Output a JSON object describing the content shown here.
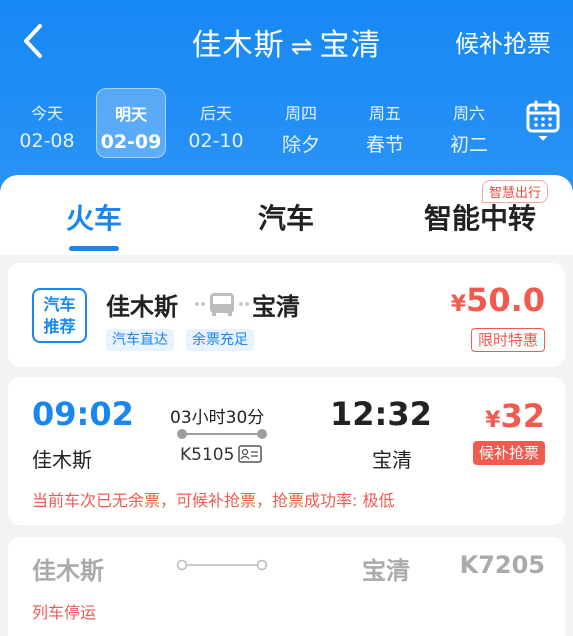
{
  "header": {
    "from": "佳木斯",
    "swap": "⇌",
    "to": "宝清",
    "action": "候补抢票"
  },
  "dates": [
    {
      "week": "今天",
      "date": "02-08"
    },
    {
      "week": "明天",
      "date": "02-09",
      "active": true
    },
    {
      "week": "后天",
      "date": "02-10"
    },
    {
      "week": "周四",
      "date": "除夕"
    },
    {
      "week": "周五",
      "date": "春节"
    },
    {
      "week": "周六",
      "date": "初二"
    }
  ],
  "tabs": {
    "train": "火车",
    "bus": "汽车",
    "transfer": "智能中转",
    "smart_tag": "智慧出行"
  },
  "bus_card": {
    "badge_line1": "汽车",
    "badge_line2": "推荐",
    "from": "佳木斯",
    "to": "宝清",
    "chips": [
      "汽车直达",
      "余票充足"
    ],
    "currency": "¥",
    "price": "50.0",
    "promo": "限时特惠"
  },
  "train_card": {
    "depart_time": "09:02",
    "duration": "03小时30分",
    "arrive_time": "12:32",
    "from": "佳木斯",
    "train_no": "K5105",
    "to": "宝清",
    "currency": "¥",
    "price": "32",
    "action": "候补抢票",
    "notice": "当前车次已无余票，可候补抢票，抢票成功率: 极低"
  },
  "stopped_card": {
    "from": "佳木斯",
    "to": "宝清",
    "train_no": "K7205",
    "status": "列车停运"
  },
  "colors": {
    "brand_blue": "#1a86f0",
    "price_red": "#f05a4f"
  }
}
